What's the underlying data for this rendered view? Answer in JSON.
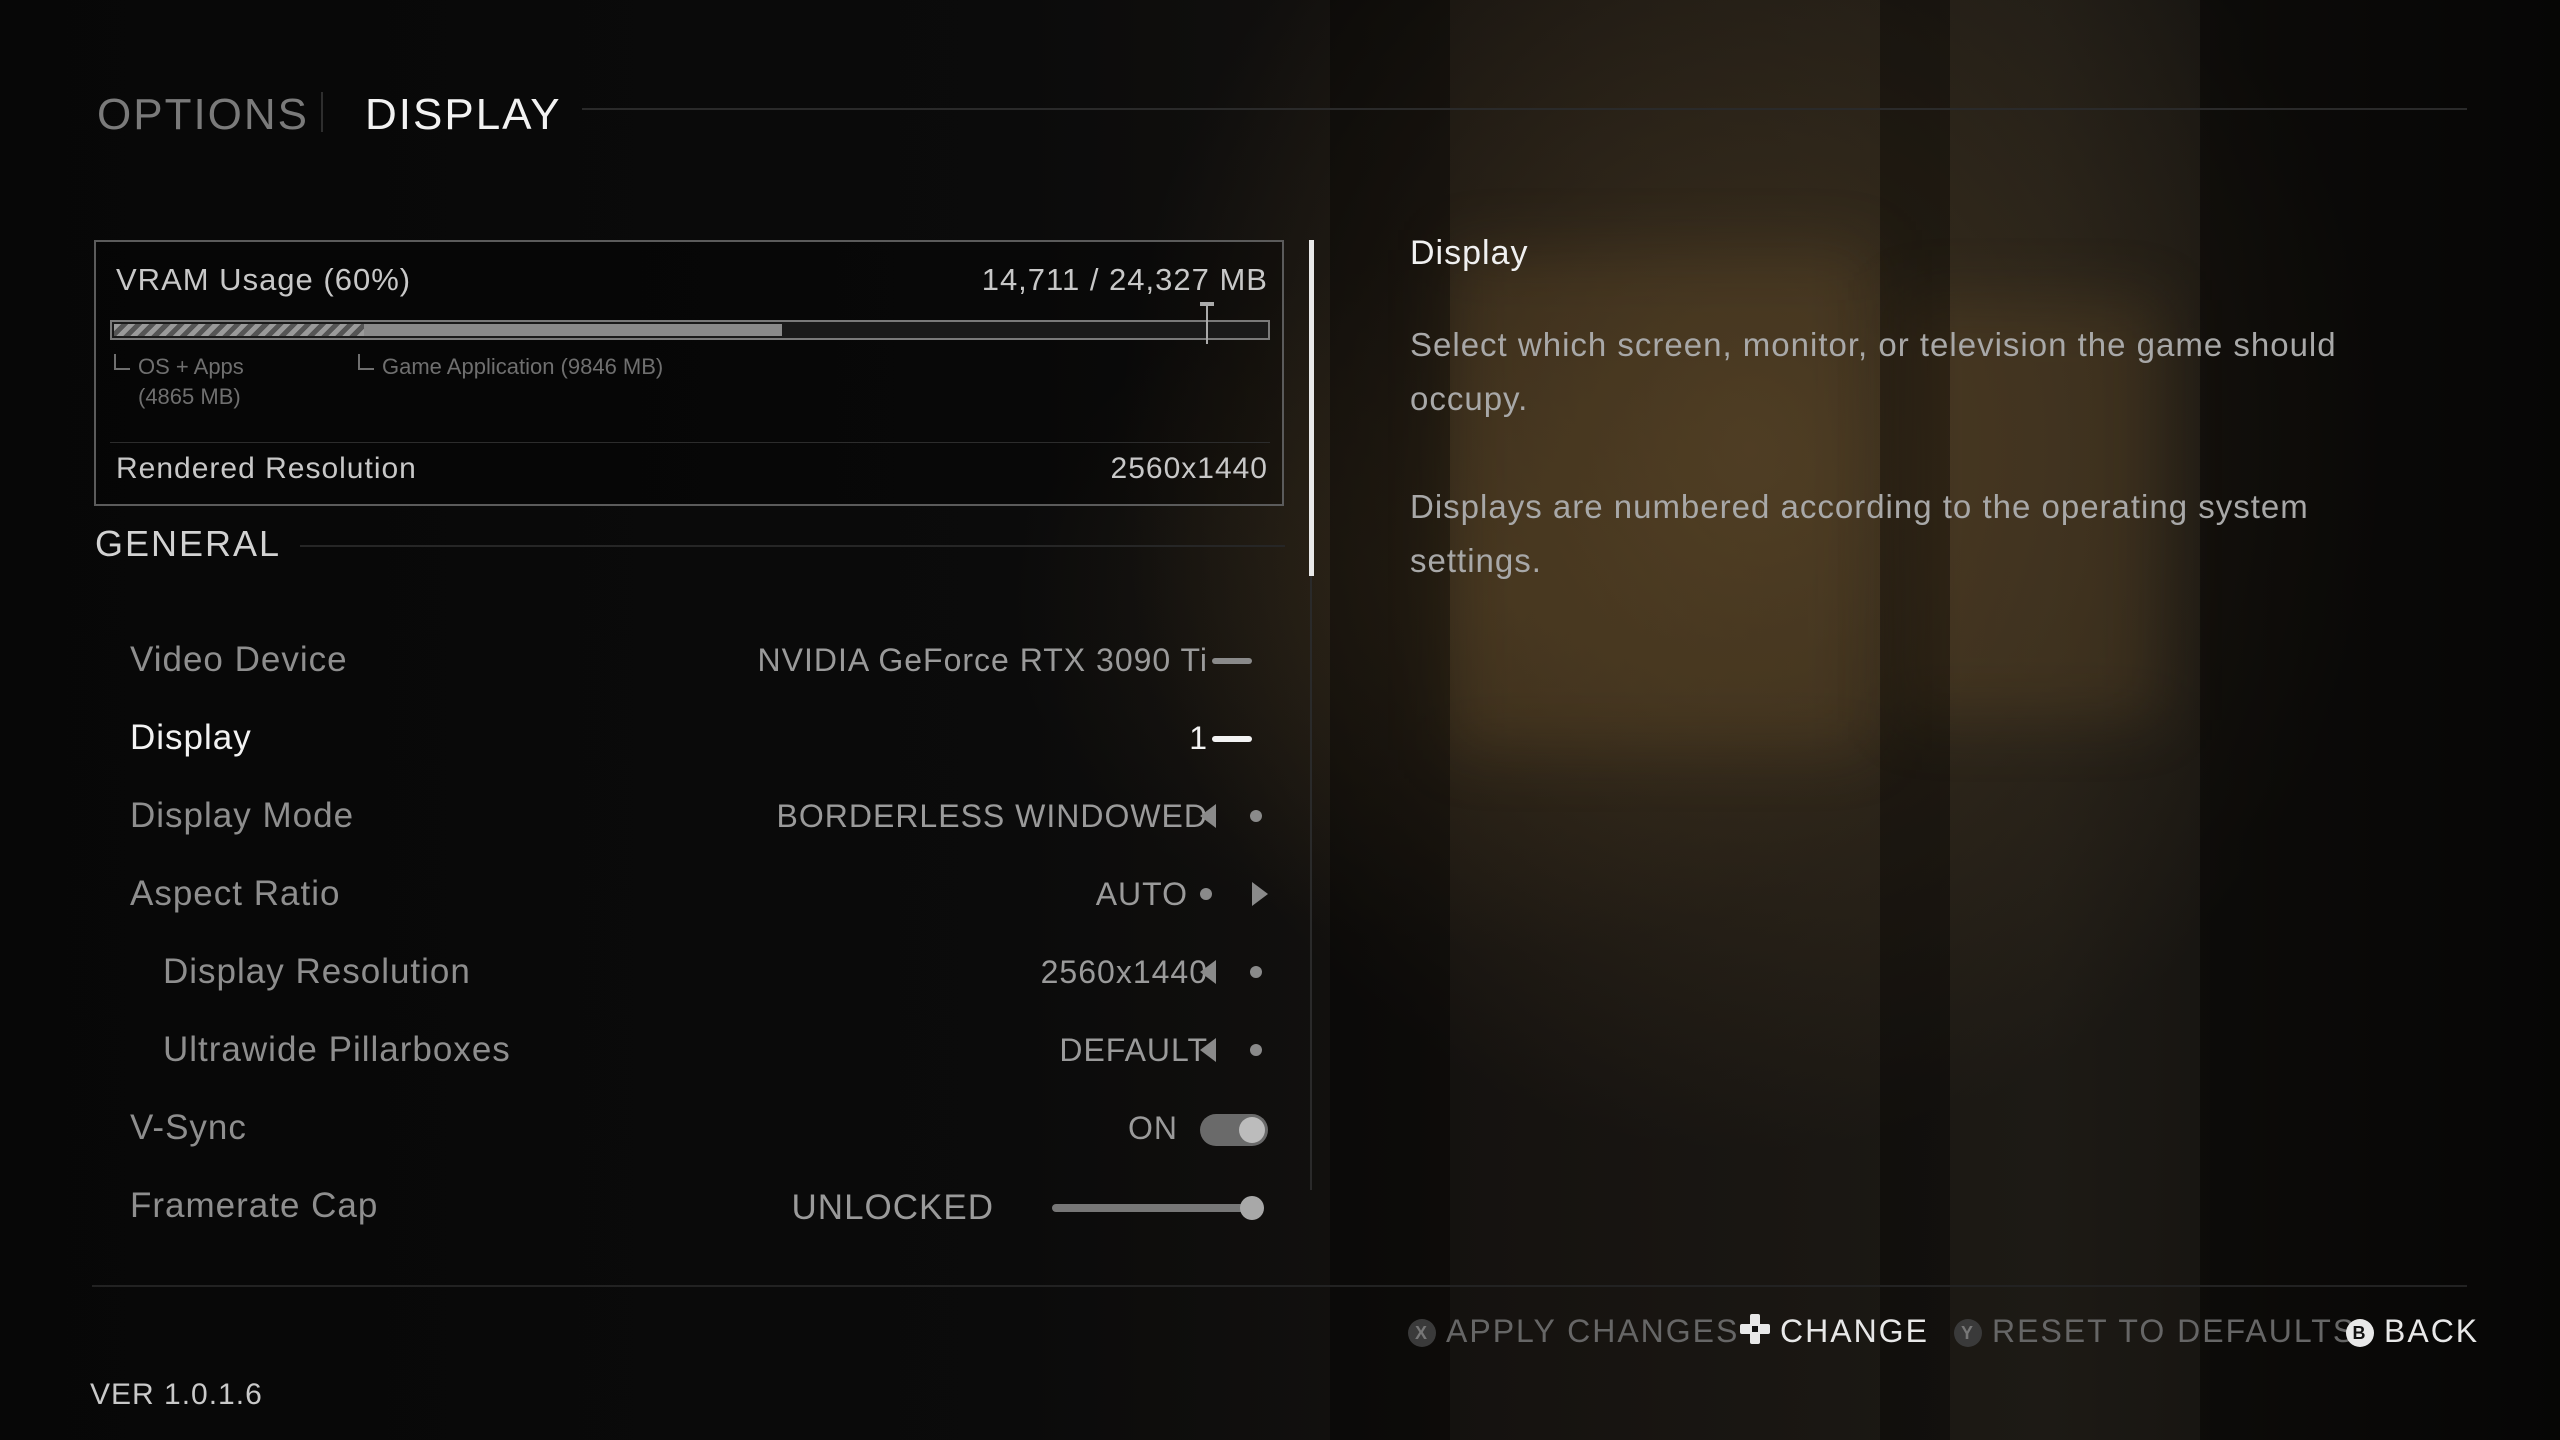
{
  "header": {
    "breadcrumb_parent": "OPTIONS",
    "breadcrumb_current": "DISPLAY"
  },
  "vram": {
    "title": "VRAM Usage (60%)",
    "total": "14,711 / 24,327 MB",
    "os_label_line1": "OS + Apps",
    "os_label_line2": "(4865 MB)",
    "game_label": "Game Application (9846 MB)",
    "rendered_resolution_label": "Rendered Resolution",
    "rendered_resolution_value": "2560x1440"
  },
  "section": {
    "title": "GENERAL"
  },
  "settings": [
    {
      "label": "Video Device",
      "value": "NVIDIA GeForce RTX 3090 Ti",
      "control": "dash"
    },
    {
      "label": "Display",
      "value": "1",
      "control": "dash",
      "active": true
    },
    {
      "label": "Display Mode",
      "value": "BORDERLESS WINDOWED",
      "control": "arrow-left-dot"
    },
    {
      "label": "Aspect Ratio",
      "value": "AUTO",
      "control": "dot-arrow-right"
    },
    {
      "label": "Display Resolution",
      "value": "2560x1440",
      "control": "arrow-left-dot"
    },
    {
      "label": "Ultrawide Pillarboxes",
      "value": "DEFAULT",
      "control": "arrow-left-dot"
    },
    {
      "label": "V-Sync",
      "value": "ON",
      "control": "toggle"
    },
    {
      "label": "Framerate Cap",
      "value": "UNLOCKED",
      "control": "slider"
    }
  ],
  "description": {
    "title": "Display",
    "paragraph1": "Select which screen, monitor, or television the game should occupy.",
    "paragraph2": "Displays are numbered according to the operating system settings."
  },
  "footer": {
    "apply_icon": "X",
    "apply_label": "APPLY CHANGES",
    "change_label": "CHANGE",
    "reset_icon": "Y",
    "reset_label": "RESET TO DEFAULTS",
    "back_icon": "B",
    "back_label": "BACK"
  },
  "version": "VER 1.0.1.6",
  "colors": {
    "accent": "#f3f3f3",
    "dim_text": "#8e8e8e",
    "panel_border": "#5b5b5b"
  }
}
